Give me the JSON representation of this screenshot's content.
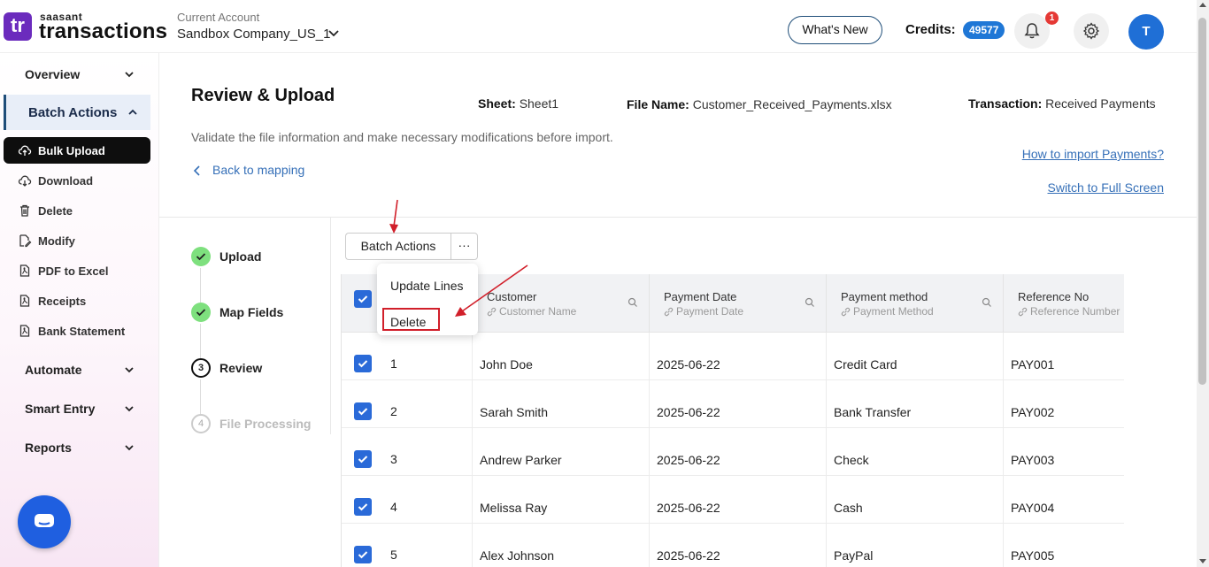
{
  "header": {
    "logo_mark": "tr",
    "logo_small": "saasant",
    "logo_big": "transactions",
    "account_label": "Current Account",
    "account_name": "Sandbox Company_US_1",
    "whats_new": "What's New",
    "credits_label": "Credits:",
    "credits_value": "49577",
    "notification_count": "1",
    "avatar_initial": "T"
  },
  "sidebar": {
    "sections": [
      {
        "label": "Overview",
        "icon": "chevron-down-icon"
      },
      {
        "label": "Batch Actions",
        "icon": "chevron-up-icon",
        "active": true
      },
      {
        "label": "Automate",
        "icon": "chevron-down-icon"
      },
      {
        "label": "Smart Entry",
        "icon": "chevron-down-icon"
      },
      {
        "label": "Reports",
        "icon": "chevron-down-icon"
      }
    ],
    "items": [
      {
        "label": "Bulk Upload",
        "icon": "cloud-upload-icon",
        "active": true
      },
      {
        "label": "Download",
        "icon": "cloud-download-icon"
      },
      {
        "label": "Delete",
        "icon": "trash-icon"
      },
      {
        "label": "Modify",
        "icon": "file-edit-icon"
      },
      {
        "label": "PDF to Excel",
        "icon": "pdf-icon"
      },
      {
        "label": "Receipts",
        "icon": "pdf-icon"
      },
      {
        "label": "Bank Statement",
        "icon": "pdf-icon"
      }
    ],
    "chat_icon": "chat-icon"
  },
  "page": {
    "title": "Review & Upload",
    "sheet_label": "Sheet:",
    "sheet_value": "Sheet1",
    "file_label": "File Name:",
    "file_value": "Customer_Received_Payments.xlsx",
    "transaction_label": "Transaction:",
    "transaction_value": "Received Payments",
    "subtitle": "Validate the file information and make necessary modifications before import.",
    "back_link": "Back to mapping",
    "help_link": "How to import Payments?",
    "fullscreen_link": "Switch to Full Screen"
  },
  "steps": [
    {
      "label": "Upload",
      "status": "done"
    },
    {
      "label": "Map Fields",
      "status": "done"
    },
    {
      "label": "Review",
      "status": "current",
      "number": "3"
    },
    {
      "label": "File Processing",
      "status": "todo",
      "number": "4"
    }
  ],
  "toolbar": {
    "batch_actions": "Batch Actions",
    "more": "···"
  },
  "dropdown": {
    "items": [
      "Update Lines",
      "Delete"
    ]
  },
  "table": {
    "columns": [
      {
        "title": "Customer",
        "subtitle": "Customer Name"
      },
      {
        "title": "Payment Date",
        "subtitle": "Payment Date"
      },
      {
        "title": "Payment method",
        "subtitle": "Payment Method"
      },
      {
        "title": "Reference No",
        "subtitle": "Reference Number"
      }
    ],
    "rows": [
      {
        "num": "1",
        "customer": "John Doe",
        "date": "2025-06-22",
        "method": "Credit Card",
        "ref": "PAY001"
      },
      {
        "num": "2",
        "customer": "Sarah Smith",
        "date": "2025-06-22",
        "method": "Bank Transfer",
        "ref": "PAY002"
      },
      {
        "num": "3",
        "customer": "Andrew Parker",
        "date": "2025-06-22",
        "method": "Check",
        "ref": "PAY003"
      },
      {
        "num": "4",
        "customer": "Melissa Ray",
        "date": "2025-06-22",
        "method": "Cash",
        "ref": "PAY004"
      },
      {
        "num": "5",
        "customer": "Alex Johnson",
        "date": "2025-06-22",
        "method": "PayPal",
        "ref": "PAY005"
      }
    ]
  },
  "colors": {
    "brand": "#6b2bbd",
    "accent": "#1f77d6",
    "link": "#3670b8",
    "checkbox": "#2a6ad8",
    "annotation": "#d11f2a",
    "step_done": "#7ee07e"
  }
}
